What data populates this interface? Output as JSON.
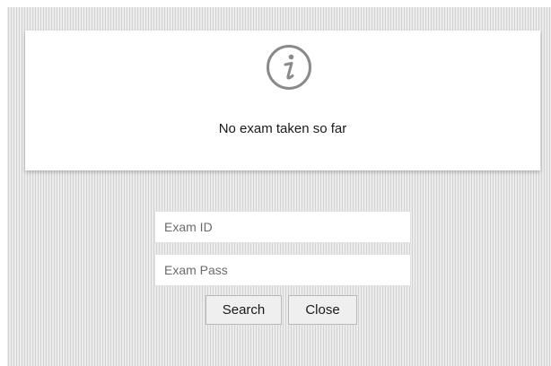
{
  "notice": {
    "icon": "info-icon",
    "message": "No exam taken so far"
  },
  "form": {
    "exam_id": {
      "value": "",
      "placeholder": "Exam ID"
    },
    "exam_pass": {
      "value": "",
      "placeholder": "Exam Pass"
    },
    "search_label": "Search",
    "close_label": "Close"
  },
  "colors": {
    "icon": "#8a8a8a",
    "background_stripe_dark": "#d2d2d2",
    "background_stripe_light": "#ececec",
    "button_background": "#efefef"
  }
}
